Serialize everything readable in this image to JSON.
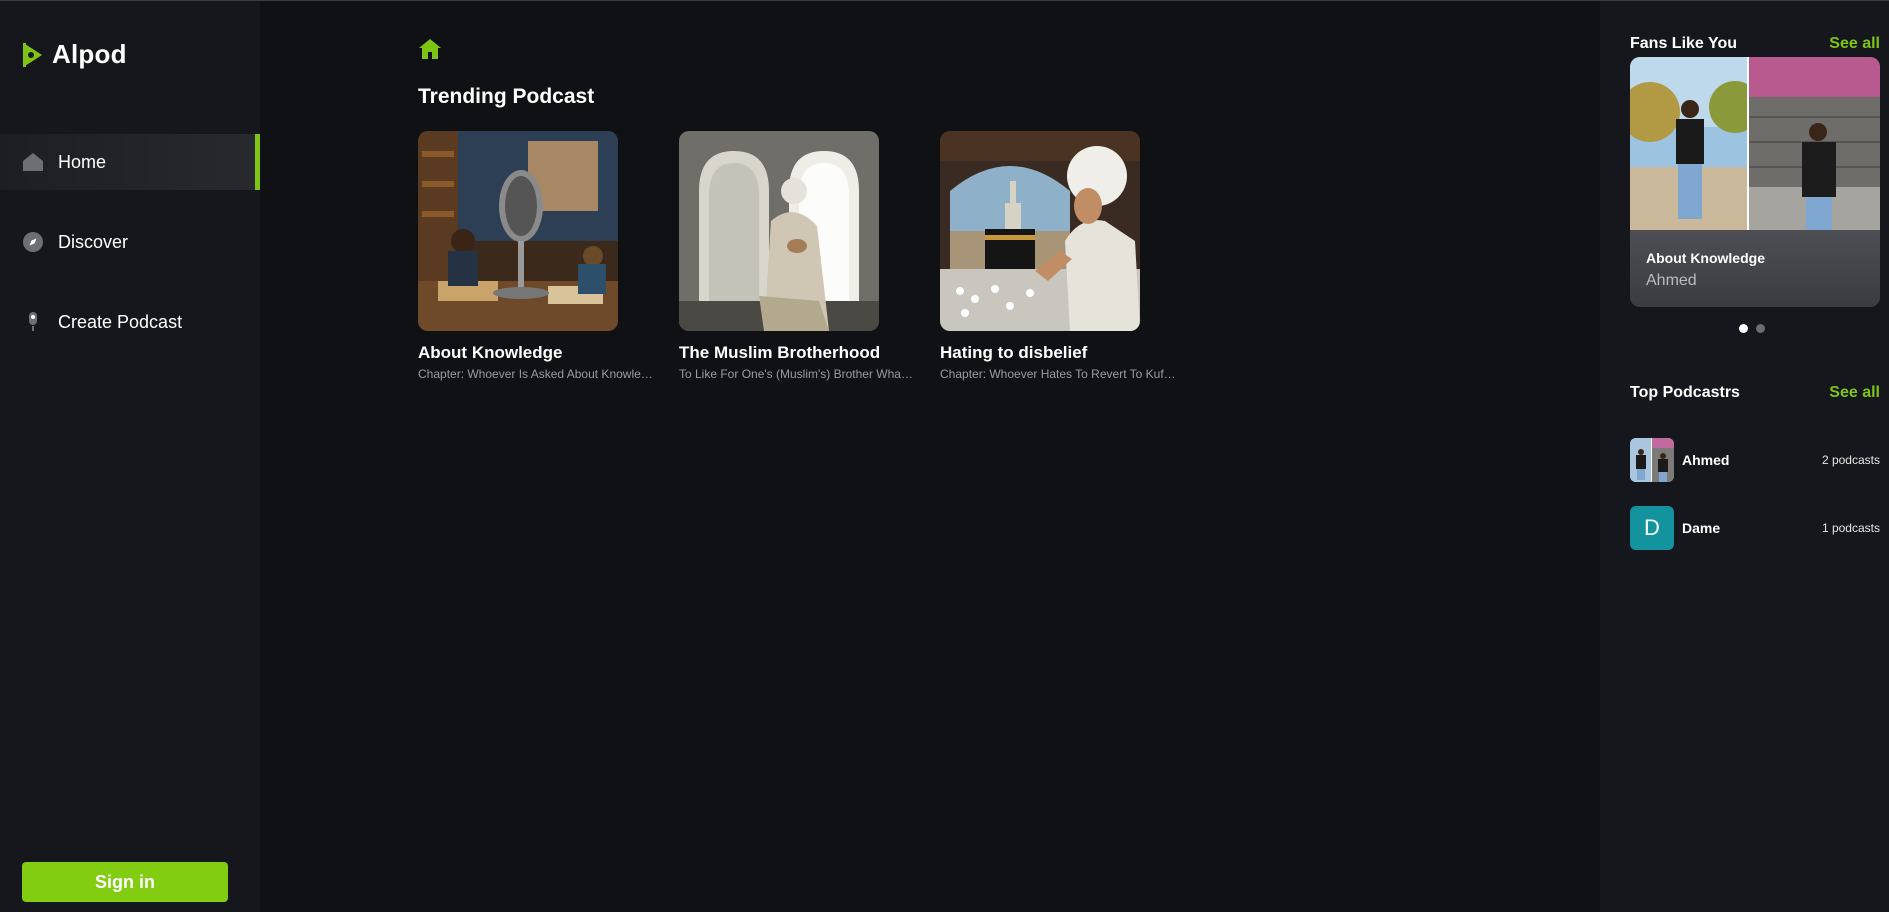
{
  "app": {
    "name": "Alpod"
  },
  "colors": {
    "accent": "#7ec415",
    "background": "#101114",
    "panel": "#15171c"
  },
  "sidebar": {
    "items": [
      {
        "label": "Home",
        "icon": "home-icon",
        "active": true
      },
      {
        "label": "Discover",
        "icon": "compass-icon",
        "active": false
      },
      {
        "label": "Create Podcast",
        "icon": "microphone-icon",
        "active": false
      }
    ],
    "signin_label": "Sign in"
  },
  "main": {
    "breadcrumb_icon": "home-icon",
    "section_title": "Trending Podcast",
    "podcasts": [
      {
        "title": "About Knowledge",
        "subtitle": "Chapter: Whoever Is Asked About Knowledge And Conceals It"
      },
      {
        "title": "The Muslim Brotherhood",
        "subtitle": "To Like For One's (Muslim's) Brother What One Likes For Himself"
      },
      {
        "title": "Hating to disbelief",
        "subtitle": "Chapter: Whoever Hates To Revert To Kufr (Disbelief)"
      }
    ]
  },
  "rightbar": {
    "fans": {
      "title": "Fans Like You",
      "see_all": "See all",
      "card": {
        "title": "About Knowledge",
        "author": "Ahmed"
      },
      "slides": 2,
      "active_slide": 0
    },
    "top": {
      "title": "Top Podcastrs",
      "see_all": "See all",
      "podcasters": [
        {
          "name": "Ahmed",
          "count": "2 podcasts",
          "avatar": "photo"
        },
        {
          "name": "Dame",
          "count": "1 podcasts",
          "avatar_letter": "D"
        }
      ]
    }
  }
}
